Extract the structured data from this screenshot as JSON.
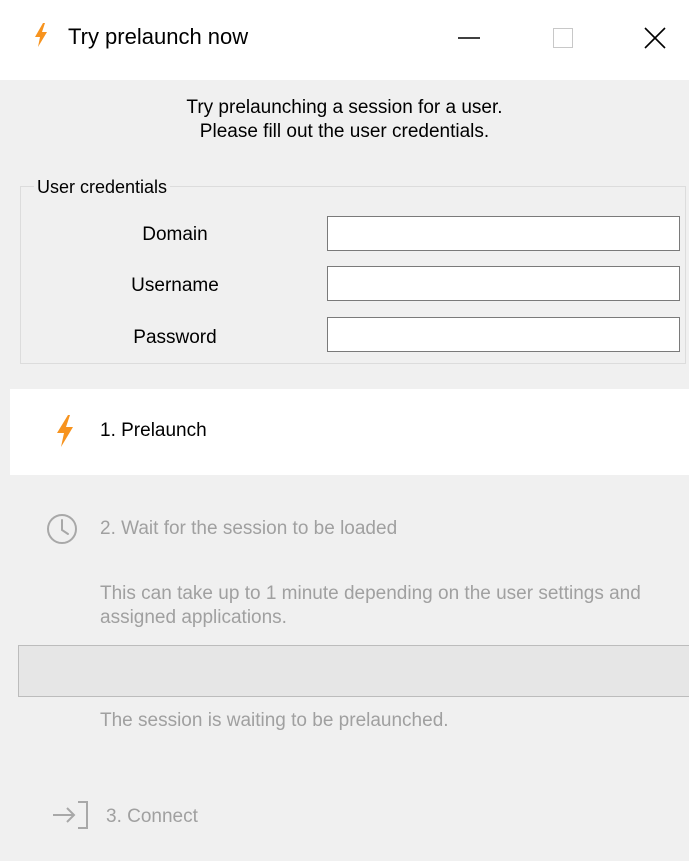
{
  "window": {
    "title": "Try prelaunch now",
    "icon": "lightning-bolt-icon",
    "controls": [
      "minimize",
      "maximize",
      "close"
    ]
  },
  "intro": {
    "line1": "Try prelaunching a session for a user.",
    "line2": "Please fill out the user credentials."
  },
  "credentials": {
    "group_label": "User credentials",
    "domain_label": "Domain",
    "domain_value": "",
    "username_label": "Username",
    "username_value": "",
    "password_label": "Password",
    "password_value": ""
  },
  "steps": {
    "prelaunch": {
      "label": "1. Prelaunch",
      "icon": "lightning-bolt-icon"
    },
    "wait": {
      "label": "2. Wait for the session to be loaded",
      "icon": "clock-icon",
      "description": "This can take up to 1 minute depending on the user settings and assigned applications.",
      "progress": 0,
      "status": "The session is waiting to be prelaunched."
    },
    "connect": {
      "label": "3. Connect",
      "icon": "sign-in-arrow-icon"
    }
  },
  "colors": {
    "accent": "#f7931e",
    "disabled_text": "#a0a0a0",
    "panel_bg": "#f0f0f0",
    "window_bg": "#ffffff"
  }
}
